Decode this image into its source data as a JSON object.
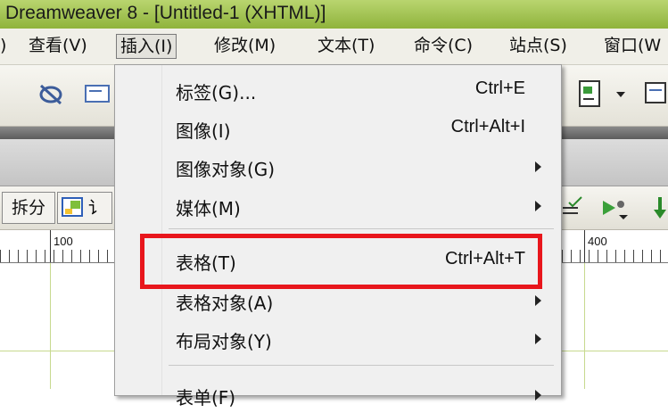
{
  "window": {
    "title": "Dreamweaver 8 - [Untitled-1 (XHTML)]"
  },
  "menubar": {
    "items": [
      {
        "label": ")"
      },
      {
        "label": "查看(V)"
      },
      {
        "label": "插入(I)"
      },
      {
        "label": "修改(M)"
      },
      {
        "label": "文本(T)"
      },
      {
        "label": "命令(C)"
      },
      {
        "label": "站点(S)"
      },
      {
        "label": "窗口(W"
      }
    ],
    "active_index": 2
  },
  "viewbar": {
    "split_label": "拆分",
    "design_partial": "讠"
  },
  "ruler": {
    "labels": [
      "100",
      "400"
    ]
  },
  "insert_menu": {
    "items": [
      {
        "label": "标签(G)...",
        "shortcut": "Ctrl+E",
        "submenu": false
      },
      {
        "label": "图像(I)",
        "shortcut": "Ctrl+Alt+I",
        "submenu": false
      },
      {
        "label": "图像对象(G)",
        "shortcut": "",
        "submenu": true
      },
      {
        "label": "媒体(M)",
        "shortcut": "",
        "submenu": true
      },
      {
        "label": "表格(T)",
        "shortcut": "Ctrl+Alt+T",
        "submenu": false
      },
      {
        "label": "表格对象(A)",
        "shortcut": "",
        "submenu": true
      },
      {
        "label": "布局对象(Y)",
        "shortcut": "",
        "submenu": true
      },
      {
        "label": "表单(F)",
        "shortcut": "",
        "submenu": true
      }
    ]
  },
  "annotation": {
    "color": "#e8161c",
    "target": "表格(T)"
  }
}
